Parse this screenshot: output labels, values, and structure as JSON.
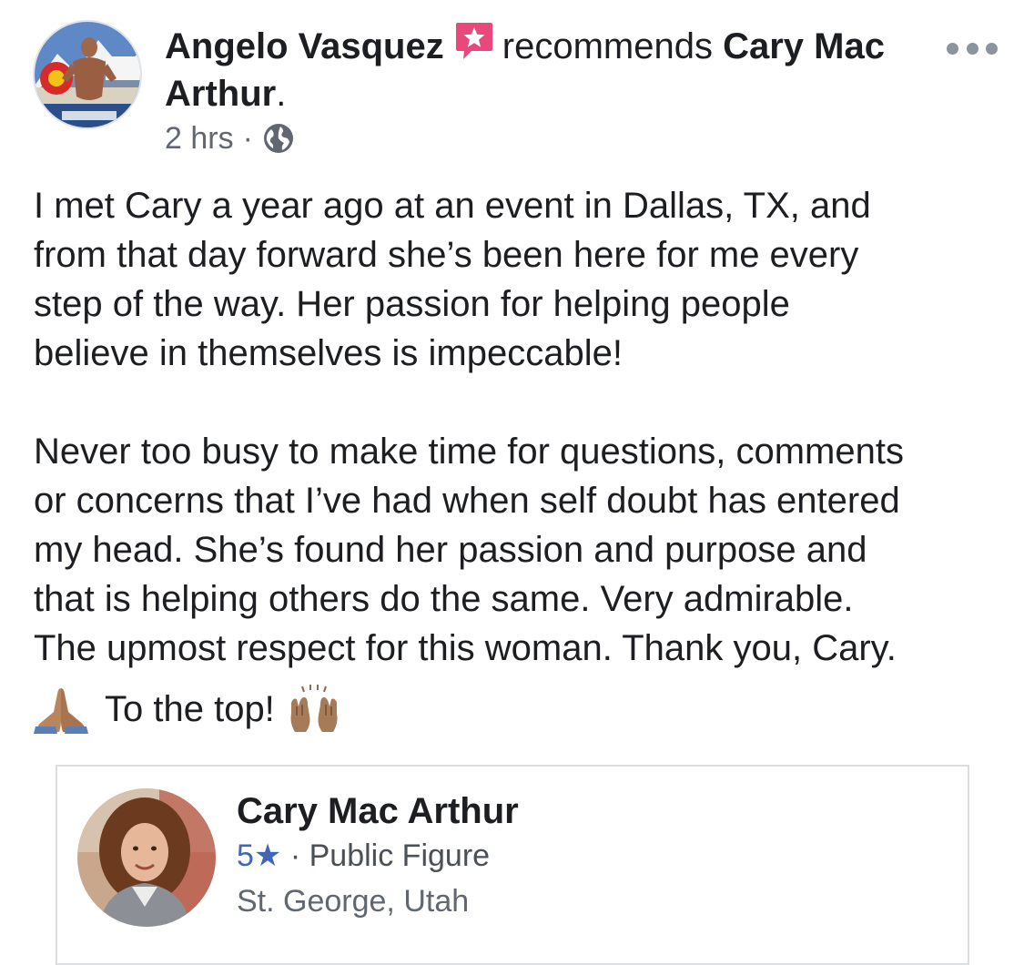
{
  "post": {
    "author": {
      "name": "Angelo Vasquez",
      "avatar_icon": "profile-photo-bodybuilder"
    },
    "action_text": "recommends",
    "target_page": "Cary Mac Arthur",
    "target_suffix": ".",
    "timestamp": "2 hrs",
    "separator": "·",
    "privacy_icon": "globe-icon",
    "body_paragraph_1": "I met Cary a year ago at an event in Dallas, TX, and\nfrom that day forward she’s been here for me every\nstep of the way. Her passion for helping people\nbelieve in themselves is impeccable!",
    "body_paragraph_2": "Never too busy to make time for questions, comments\nor concerns that I’ve had when self doubt has entered\nmy head. She’s found her passion and purpose and\nthat is helping others do the same. Very admirable.\nThe upmost respect for this woman. Thank you, Cary.",
    "closing_text": "To the top!",
    "closing_emojis": [
      "folded-hands-emoji",
      "raising-hands-emoji"
    ]
  },
  "page_card": {
    "name": "Cary Mac Arthur",
    "rating": "5★",
    "separator": "·",
    "category": "Public Figure",
    "location": "St. George, Utah"
  },
  "colors": {
    "badge_pink": "#e8487a",
    "meta_gray": "#606770",
    "rating_blue": "#4267b2",
    "border_gray": "#dadde1"
  }
}
